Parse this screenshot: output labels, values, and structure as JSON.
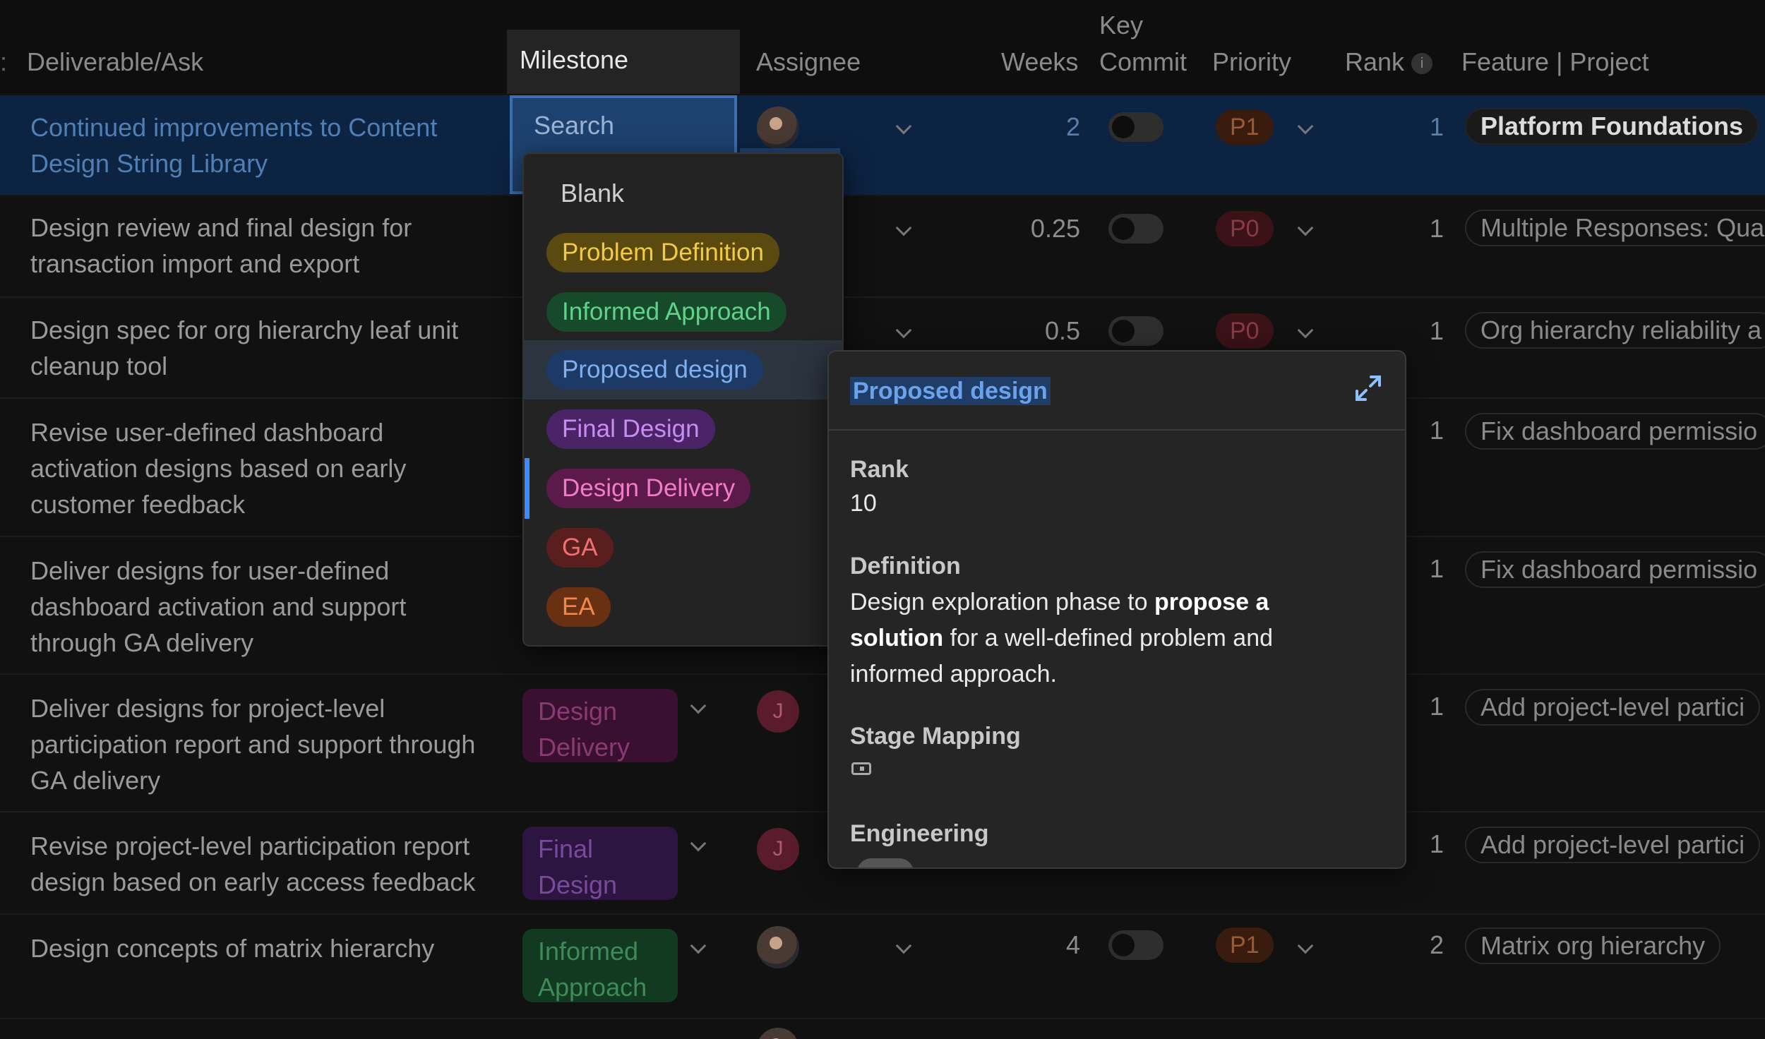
{
  "header": {
    "deliverable": "Deliverable/Ask",
    "milestone": "Milestone",
    "assignee": "Assignee",
    "weeks": "Weeks",
    "key_commit_line1": "Key",
    "key_commit_line2": "Commit",
    "priority": "Priority",
    "rank": "Rank",
    "rank_info": "i",
    "feature": "Feature | Project"
  },
  "search": {
    "placeholder": "Search"
  },
  "rows": [
    {
      "task": "Continued improvements to Content Design String Library",
      "weeks": "2",
      "priority": "P1",
      "rank": "1",
      "feature": "Platform Foundations"
    },
    {
      "task": "Design review and final design for transaction import and export",
      "weeks": "0.25",
      "priority": "P0",
      "rank": "1",
      "feature": "Multiple Responses: Qua"
    },
    {
      "task": "Design spec for org hierarchy leaf unit cleanup tool",
      "weeks": "0.5",
      "priority": "P0",
      "rank": "1",
      "feature": "Org hierarchy reliability a"
    },
    {
      "task": "Revise user-defined dashboard activation designs based on early customer feedback",
      "rank": "1",
      "feature": "Fix dashboard permissio"
    },
    {
      "task": "Deliver designs for user-defined dashboard activation and support through GA delivery",
      "rank": "1",
      "feature": "Fix dashboard permissio"
    },
    {
      "task": "Deliver designs for project-level participation report and support through GA delivery",
      "milestone_l1": "Design",
      "milestone_l2": "Delivery",
      "avatar": "J",
      "rank": "1",
      "feature": "Add project-level partici"
    },
    {
      "task": "Revise project-level participation report design based on early access feedback",
      "milestone_l1": "Final",
      "milestone_l2": "Design",
      "avatar": "J",
      "rank": "1",
      "feature": "Add project-level partici"
    },
    {
      "task": "Design concepts of matrix hierarchy",
      "milestone_l1": "Informed",
      "milestone_l2": "Approach",
      "weeks": "4",
      "priority": "P1",
      "rank": "2",
      "feature": "Matrix org hierarchy"
    }
  ],
  "dropdown": {
    "options": [
      {
        "label": "Blank"
      },
      {
        "label": "Problem Definition",
        "bg": "#5a4a10",
        "fg": "#f2c94c"
      },
      {
        "label": "Informed Approach",
        "bg": "#164a2a",
        "fg": "#5fd38a"
      },
      {
        "label": "Proposed design",
        "bg": "#1d3a66",
        "fg": "#7fb0f0"
      },
      {
        "label": "Final Design",
        "bg": "#4a2466",
        "fg": "#c98cf0"
      },
      {
        "label": "Design Delivery",
        "bg": "#5c1a4a",
        "fg": "#f07cc8"
      },
      {
        "label": "GA",
        "bg": "#5a1e1e",
        "fg": "#f07070"
      },
      {
        "label": "EA",
        "bg": "#6a3012",
        "fg": "#f0884a"
      }
    ]
  },
  "popover": {
    "title": "Proposed design",
    "rank_label": "Rank",
    "rank_value": "10",
    "definition_label": "Definition",
    "def_part1": "Design exploration phase to ",
    "def_bold": "propose a solution",
    "def_part2": " for a well-defined problem and informed approach.",
    "stage_label": "Stage Mapping",
    "engineering_label": "Engineering"
  },
  "colors": {
    "selected_row": "#0c2342",
    "accent": "#3b8bff",
    "milestone_design_delivery_bg": "#3a1030",
    "milestone_design_delivery_fg": "#8a3a72",
    "milestone_final_design_bg": "#2c1540",
    "milestone_final_design_fg": "#7a4a9a",
    "milestone_informed_bg": "#123a20",
    "milestone_informed_fg": "#3e8a58"
  }
}
